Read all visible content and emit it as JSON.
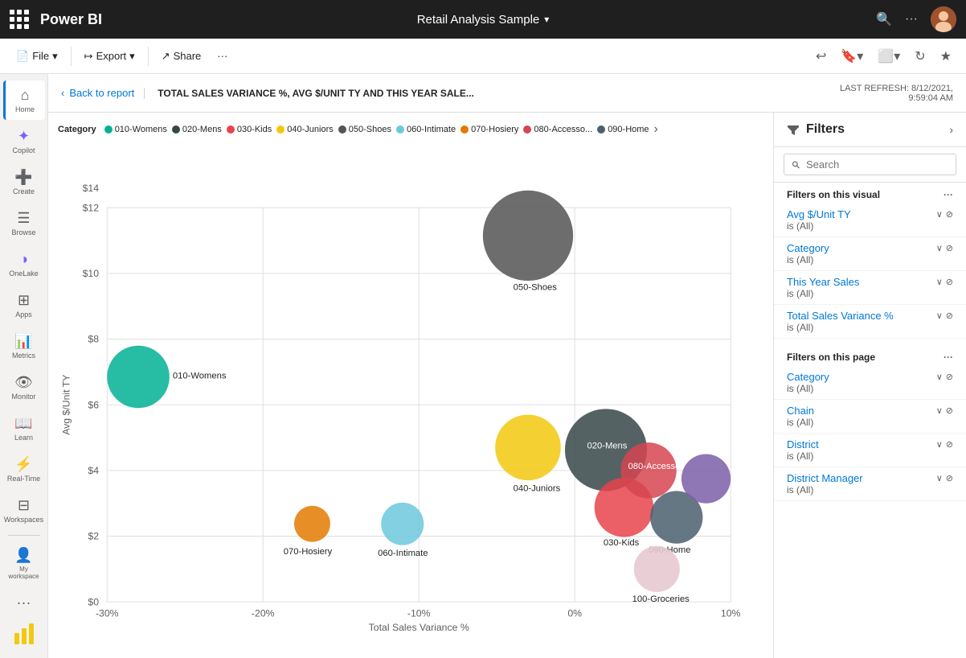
{
  "topbar": {
    "app_icon": "grid-icon",
    "logo": "Power BI",
    "title": "Retail Analysis Sample",
    "title_chevron": "▾",
    "search_icon": "🔍",
    "more_icon": "...",
    "accent": "#0078d4"
  },
  "commandbar": {
    "file_label": "File",
    "export_label": "Export",
    "share_label": "Share",
    "more": "···",
    "undo_icon": "↩",
    "bookmark_icon": "🔖",
    "window_icon": "⬜",
    "refresh_icon": "↻",
    "star_icon": "★"
  },
  "sidebar": {
    "items": [
      {
        "id": "home",
        "label": "Home",
        "icon": "⌂",
        "active": true
      },
      {
        "id": "copilot",
        "label": "Copilot",
        "icon": "✦"
      },
      {
        "id": "create",
        "label": "Create",
        "icon": "+"
      },
      {
        "id": "browse",
        "label": "Browse",
        "icon": "☰"
      },
      {
        "id": "onelake",
        "label": "OneLake",
        "icon": "◑"
      },
      {
        "id": "apps",
        "label": "Apps",
        "icon": "⊞"
      },
      {
        "id": "metrics",
        "label": "Metrics",
        "icon": "📊"
      },
      {
        "id": "monitor",
        "label": "Monitor",
        "icon": "👁"
      },
      {
        "id": "learn",
        "label": "Learn",
        "icon": "📖"
      },
      {
        "id": "realtime",
        "label": "Real-Time",
        "icon": "⚡"
      },
      {
        "id": "workspaces",
        "label": "Workspaces",
        "icon": "⊟"
      },
      {
        "id": "myworkspace",
        "label": "My workspace",
        "icon": "👤"
      },
      {
        "id": "more",
        "label": "...",
        "icon": "···"
      }
    ]
  },
  "report_header": {
    "back_label": "Back to report",
    "back_chevron": "‹",
    "title": "TOTAL SALES VARIANCE %, AVG $/UNIT TY AND THIS YEAR SALE...",
    "refresh_line1": "LAST REFRESH: 8/12/2021,",
    "refresh_line2": "9:59:04 AM"
  },
  "legend": {
    "category_label": "Category",
    "items": [
      {
        "id": "010-Womens",
        "label": "010-Womens",
        "color": "#00b294"
      },
      {
        "id": "020-Mens",
        "label": "020-Mens",
        "color": "#374649"
      },
      {
        "id": "030-Kids",
        "label": "030-Kids",
        "color": "#e8434b"
      },
      {
        "id": "040-Juniors",
        "label": "040-Juniors",
        "color": "#f2c80f"
      },
      {
        "id": "050-Shoes",
        "label": "050-Shoes",
        "color": "#545454"
      },
      {
        "id": "060-Intimate",
        "label": "060-Intimate",
        "color": "#6dc8de"
      },
      {
        "id": "070-Hosiery",
        "label": "070-Hosiery",
        "color": "#e37a00"
      },
      {
        "id": "080-Accesso",
        "label": "080-Accesso...",
        "color": "#d64550"
      },
      {
        "id": "090-Home",
        "label": "090-Home",
        "color": "#4b5f6e"
      }
    ]
  },
  "scatter": {
    "x_axis_label": "Total Sales Variance %",
    "y_axis_label": "Avg $/Unit TY",
    "x_ticks": [
      "-30%",
      "-20%",
      "-10%",
      "0%",
      "10%"
    ],
    "y_ticks": [
      "$0",
      "$2",
      "$4",
      "$6",
      "$8",
      "$10",
      "$12",
      "$14"
    ],
    "bubbles": [
      {
        "id": "010-Womens",
        "label": "010-Womens",
        "cx_pct": 5,
        "cy_pct": 43,
        "r": 38,
        "color": "#00b294"
      },
      {
        "id": "020-Mens",
        "label": "020-Mens",
        "cx_pct": 77,
        "cy_pct": 50,
        "r": 50,
        "color": "#374649"
      },
      {
        "id": "030-Kids",
        "label": "030-Kids",
        "cx_pct": 78,
        "cy_pct": 64,
        "r": 36,
        "color": "#e8434b"
      },
      {
        "id": "040-Juniors",
        "label": "040-Juniors",
        "cx_pct": 65,
        "cy_pct": 50,
        "r": 40,
        "color": "#f2c80f"
      },
      {
        "id": "050-Shoes",
        "label": "050-Shoes",
        "cx_pct": 66,
        "cy_pct": 14,
        "r": 55,
        "color": "#545454"
      },
      {
        "id": "060-Intimate",
        "label": "060-Intimate",
        "cx_pct": 42,
        "cy_pct": 68,
        "r": 26,
        "color": "#6dc8de"
      },
      {
        "id": "070-Hosiery",
        "label": "070-Hosiery",
        "cx_pct": 32,
        "cy_pct": 73,
        "r": 22,
        "color": "#e37a00"
      },
      {
        "id": "080-Accessories",
        "label": "080-Accessories",
        "cx_pct": 81,
        "cy_pct": 57,
        "r": 34,
        "color": "#d64550"
      },
      {
        "id": "090-Home",
        "label": "090-Home",
        "cx_pct": 87,
        "cy_pct": 72,
        "r": 32,
        "color": "#4b5f6e"
      },
      {
        "id": "100-Groceries",
        "label": "100-Groceries",
        "cx_pct": 84,
        "cy_pct": 85,
        "r": 28,
        "color": "#e8c9d0"
      }
    ]
  },
  "filters": {
    "title": "Filters",
    "search_placeholder": "Search",
    "filters_on_visual_label": "Filters on this visual",
    "filters_on_page_label": "Filters on this page",
    "visual_filters": [
      {
        "name": "Avg $/Unit TY",
        "value": "is (All)"
      },
      {
        "name": "Category",
        "value": "is (All)"
      },
      {
        "name": "This Year Sales",
        "value": "is (All)"
      },
      {
        "name": "Total Sales Variance %",
        "value": "is (All)"
      }
    ],
    "page_filters": [
      {
        "name": "Category",
        "value": "is (All)"
      },
      {
        "name": "Chain",
        "value": "is (All)"
      },
      {
        "name": "District",
        "value": "is (All)"
      },
      {
        "name": "District Manager",
        "value": "is (All)"
      }
    ]
  }
}
